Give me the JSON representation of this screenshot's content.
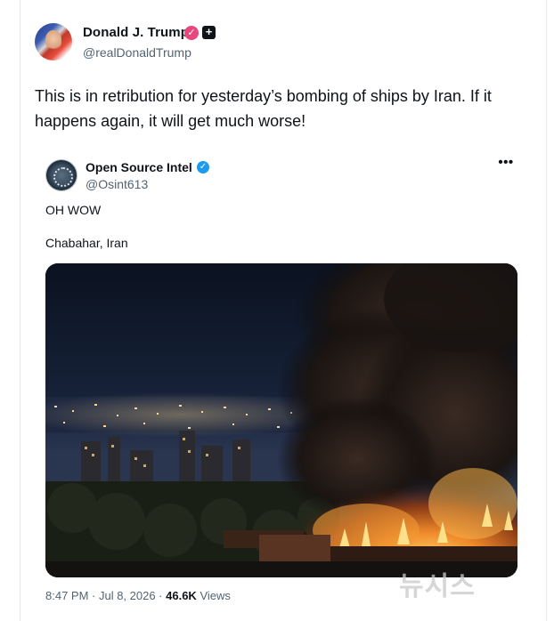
{
  "author": {
    "name": "Donald J. Trump",
    "handle": "@realDonaldTrump",
    "verified_icon": "check-badge-icon",
    "affiliate_icon": "plus-square-icon",
    "badge_color": "#e8467c"
  },
  "post": {
    "text": "This is in retribution for yesterday’s bombing of ships by Iran. If it happens again, it will get much worse!"
  },
  "quote": {
    "name": "Open Source Intel",
    "handle": "@Osint613",
    "verified_icon": "check-badge-icon",
    "badge_color": "#1d9bf0",
    "more_label": "•••",
    "line1": "OH WOW",
    "line2": "Chabahar, Iran",
    "time": "8:47 PM · Jul 8, 2026 · ",
    "views_count": "46.6K",
    "views_label": " Views"
  },
  "watermark": "뉴시스"
}
